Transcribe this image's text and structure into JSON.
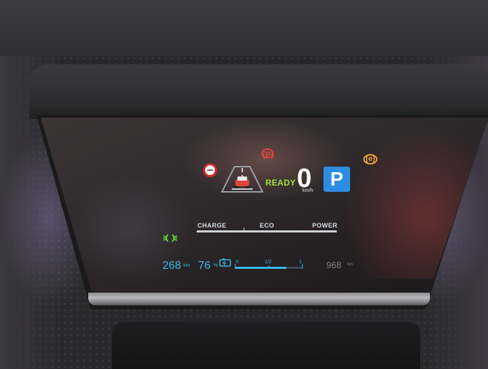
{
  "cluster": {
    "ready_label": "READY",
    "speed": "0",
    "speed_unit": "km/h",
    "gear": "P",
    "power_scale": {
      "labels": [
        "CHARGE",
        "ECO",
        "POWER"
      ]
    },
    "range": {
      "value": "268",
      "unit": "km"
    },
    "battery": {
      "value": "76",
      "unit": "%"
    },
    "gauge": {
      "labels": [
        "0",
        "1/2",
        "1"
      ],
      "fill_fraction": 0.76
    },
    "odometer": {
      "value": "968",
      "unit": "km"
    },
    "warning_icons": {
      "brake_red": "(P)",
      "brake_amber": "(e)"
    },
    "colors": {
      "ready": "#9ce13c",
      "info_blue": "#35b9e8",
      "gear_bg": "#2d8de0",
      "brake_red": "#e0443a",
      "brake_amber": "#f1a43a"
    },
    "icons": [
      "speed-limit-sign-icon",
      "lane-assist-road-icon",
      "parking-brake-icon",
      "electric-parking-brake-icon",
      "low-beam-lights-icon",
      "battery-charge-icon"
    ]
  }
}
